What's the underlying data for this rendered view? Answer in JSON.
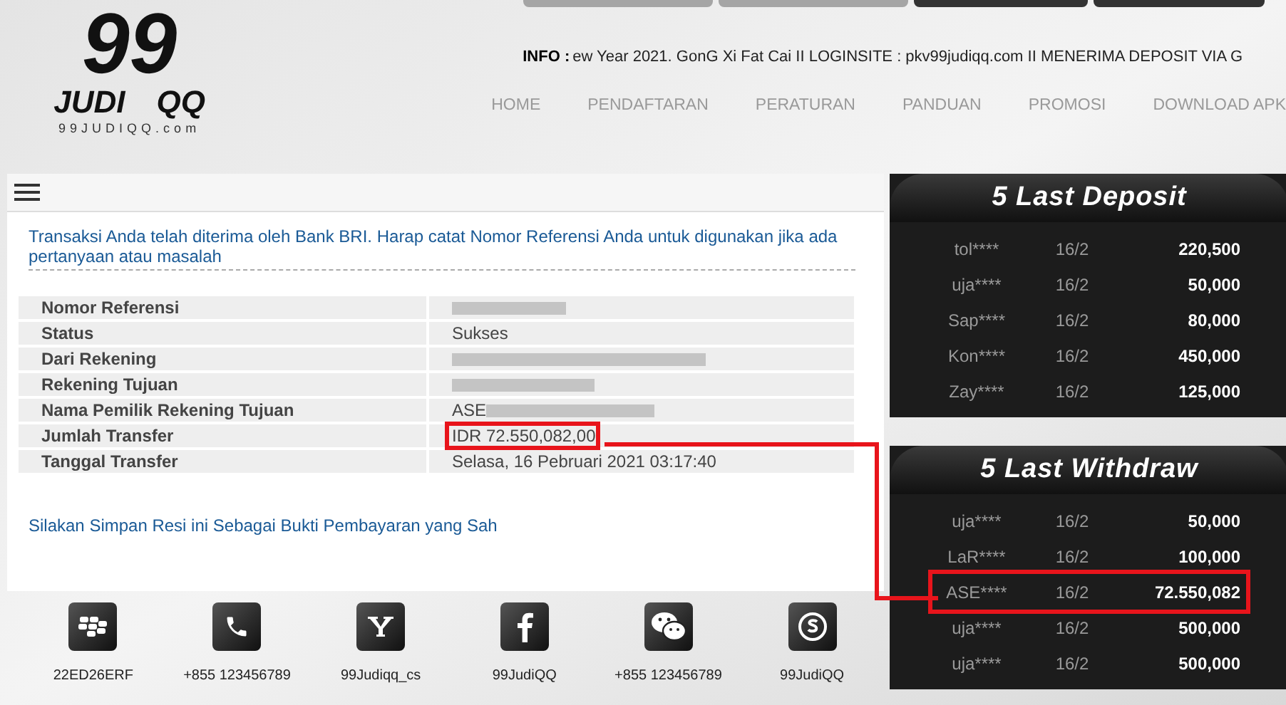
{
  "logo": {
    "numeral": "99",
    "left_word": "JUDI",
    "right_word": "QQ",
    "domain": "99JUDIQQ.com"
  },
  "info": {
    "label": "INFO :",
    "ticker": "ew Year 2021. GonG Xi Fat Cai II LOGINSITE : pkv99judiqq.com II MENERIMA DEPOSIT VIA G"
  },
  "nav": [
    {
      "label": "HOME"
    },
    {
      "label": "PENDAFTARAN"
    },
    {
      "label": "PERATURAN"
    },
    {
      "label": "PANDUAN"
    },
    {
      "label": "PROMOSI"
    },
    {
      "label": "DOWNLOAD APK"
    }
  ],
  "receipt": {
    "message": "Transaksi Anda telah diterima oleh Bank BRI. Harap catat Nomor Referensi Anda untuk digunakan jika ada pertanyaan atau masalah",
    "rows": [
      {
        "label": "Nomor Referensi",
        "redacted": true
      },
      {
        "label": "Status",
        "value": "Sukses"
      },
      {
        "label": "Dari Rekening",
        "redacted": true
      },
      {
        "label": "Rekening Tujuan",
        "redacted": true
      },
      {
        "label": "Nama Pemilik Rekening Tujuan",
        "value": "ASE",
        "redacted": true
      },
      {
        "label": "Jumlah Transfer",
        "value": "IDR 72.550,082,00",
        "highlighted": true
      },
      {
        "label": "Tanggal Transfer",
        "value": "Selasa, 16 Pebruari 2021 03:17:40"
      }
    ],
    "footer_note": "Silakan Simpan Resi ini Sebagai Bukti Pembayaran yang Sah"
  },
  "contacts": [
    {
      "kind": "bbm",
      "label": "22ED26ERF"
    },
    {
      "kind": "phone",
      "label": "+855 123456789"
    },
    {
      "kind": "yahoo",
      "label": "99Judiqq_cs"
    },
    {
      "kind": "facebook",
      "label": "99JudiQQ"
    },
    {
      "kind": "wechat",
      "label": "+855 123456789"
    },
    {
      "kind": "skype",
      "label": "99JudiQQ"
    }
  ],
  "last_deposit": {
    "title": "5 Last Deposit",
    "rows": [
      {
        "user": "tol****",
        "date": "16/2",
        "amount": "220,500"
      },
      {
        "user": "uja****",
        "date": "16/2",
        "amount": "50,000"
      },
      {
        "user": "Sap****",
        "date": "16/2",
        "amount": "80,000"
      },
      {
        "user": "Kon****",
        "date": "16/2",
        "amount": "450,000"
      },
      {
        "user": "Zay****",
        "date": "16/2",
        "amount": "125,000"
      }
    ]
  },
  "last_withdraw": {
    "title": "5 Last Withdraw",
    "rows": [
      {
        "user": "uja****",
        "date": "16/2",
        "amount": "50,000"
      },
      {
        "user": "LaR****",
        "date": "16/2",
        "amount": "100,000"
      },
      {
        "user": "ASE****",
        "date": "16/2",
        "amount": "72.550,082",
        "highlighted": true
      },
      {
        "user": "uja****",
        "date": "16/2",
        "amount": "500,000"
      },
      {
        "user": "uja****",
        "date": "16/2",
        "amount": "500,000"
      }
    ]
  }
}
